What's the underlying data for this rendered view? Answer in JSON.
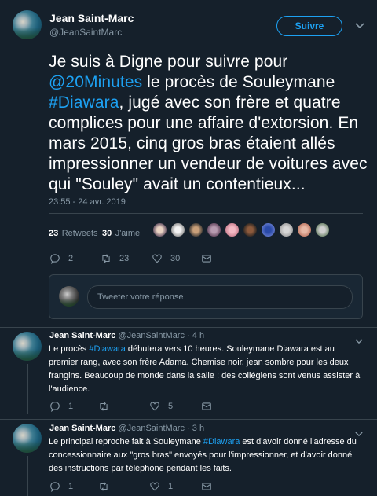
{
  "main_tweet": {
    "author_name": "Jean Saint-Marc",
    "author_handle": "@JeanSaintMarc",
    "follow_label": "Suivre",
    "text_1": "Je suis à Digne pour suivre pour ",
    "mention": "@20Minutes",
    "text_2": " le procès de Souleymane ",
    "hashtag": "#Diawara",
    "text_3": ", jugé avec son frère et quatre complices pour une affaire d'extorsion. En mars 2015, cinq gros bras étaient allés impressionner un vendeur de voitures avec qui \"Souley\" avait un contentieux...",
    "timestamp": "23:55 - 24 avr. 2019",
    "retweets_count": "23",
    "retweets_label": "Retweets",
    "likes_count": "30",
    "likes_label": "J'aime",
    "actions": {
      "reply_count": "2",
      "retweet_count": "23",
      "like_count": "30"
    }
  },
  "reply_box": {
    "placeholder": "Tweeter votre réponse"
  },
  "replies": [
    {
      "author_name": "Jean Saint-Marc",
      "author_handle": "@JeanSaintMarc",
      "time": "· 4 h",
      "text_1": "Le procès ",
      "hashtag": "#Diawara",
      "text_2": " débutera vers 10 heures. Souleymane Diawara est au premier rang, avec son frère Adama. Chemise noir, jean sombre pour les deux frangins. Beaucoup de monde dans la salle : des collégiens sont venus assister à l'audience.",
      "reply_count": "1",
      "retweet_count": "",
      "like_count": "5"
    },
    {
      "author_name": "Jean Saint-Marc",
      "author_handle": "@JeanSaintMarc",
      "time": "· 3 h",
      "text_1": "Le principal reproche fait à Souleymane ",
      "hashtag": "#Diawara",
      "text_2": " est d'avoir donné l'adresse du concessionnaire aux \"gros bras\" envoyés pour l'impressionner, et d'avoir donné des instructions par téléphone pendant les faits.",
      "reply_count": "1",
      "retweet_count": "",
      "like_count": "1"
    }
  ],
  "colors": {
    "background": "#15202b",
    "accent": "#1da1f2",
    "muted": "#8899a6",
    "border": "#38444d"
  }
}
